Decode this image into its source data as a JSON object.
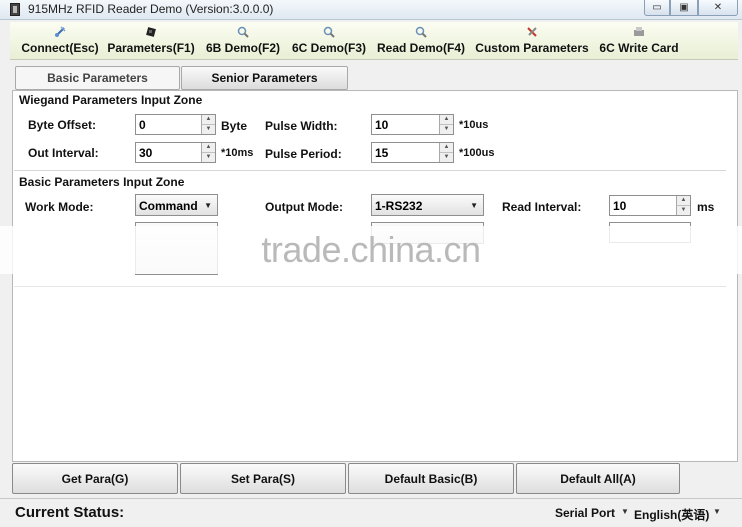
{
  "window": {
    "title": "915MHz RFID Reader Demo (Version:3.0.0.0)",
    "controls": {
      "minimize": "▭",
      "maximize": "▣",
      "close": "✕"
    }
  },
  "toolbar": [
    {
      "label": "Connect(Esc)",
      "icon": "satellite-icon"
    },
    {
      "label": "Parameters(F1)",
      "icon": "chip-icon"
    },
    {
      "label": "6B Demo(F2)",
      "icon": "magnifier-icon"
    },
    {
      "label": "6C Demo(F3)",
      "icon": "magnifier-icon"
    },
    {
      "label": "Read Demo(F4)",
      "icon": "magnifier-icon"
    },
    {
      "label": "Custom Parameters",
      "icon": "tools-icon"
    },
    {
      "label": "6C Write Card",
      "icon": "card-writer-icon"
    }
  ],
  "tabs": {
    "basic": "Basic Parameters",
    "senior": "Senior Parameters"
  },
  "wiegand": {
    "title": "Wiegand Parameters Input Zone",
    "byte_offset": {
      "label": "Byte Offset:",
      "value": "0",
      "unit": "Byte"
    },
    "pulse_width": {
      "label": "Pulse Width:",
      "value": "10",
      "unit": "*10us"
    },
    "out_interval": {
      "label": "Out Interval:",
      "value": "30",
      "unit": "*10ms"
    },
    "pulse_period": {
      "label": "Pulse Period:",
      "value": "15",
      "unit": "*100us"
    }
  },
  "basic": {
    "title": "Basic Parameters Input Zone",
    "work_mode": {
      "label": "Work Mode:",
      "value": "Command"
    },
    "output_mode": {
      "label": "Output Mode:",
      "value": "1-RS232"
    },
    "read_interval": {
      "label": "Read Interval:",
      "value": "10",
      "unit": "ms"
    }
  },
  "watermark": "trade.china.cn",
  "buttons": {
    "get_para": "Get Para(G)",
    "set_para": "Set Para(S)",
    "default_basic": "Default Basic(B)",
    "default_all": "Default All(A)"
  },
  "status": {
    "label": "Current Status:",
    "port": "Serial Port",
    "language": "English(英语)"
  }
}
